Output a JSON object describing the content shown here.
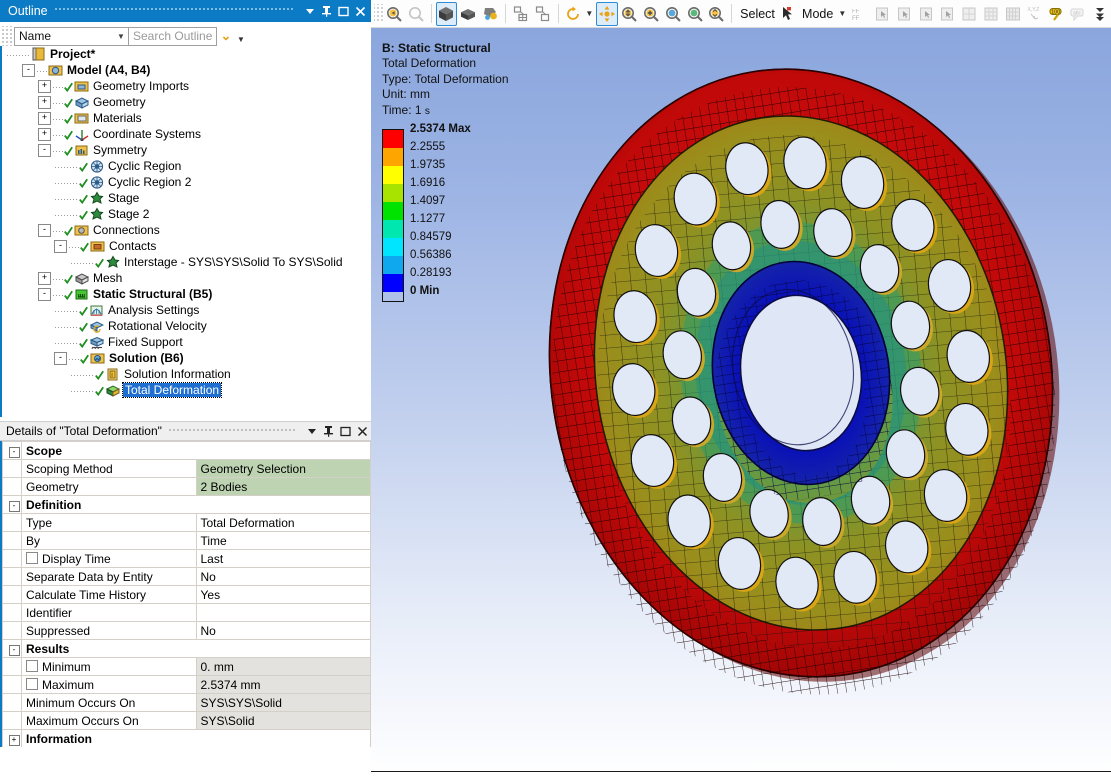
{
  "outline_panel": {
    "title": "Outline",
    "window_buttons": [
      "dropdown-arrow",
      "pin",
      "maximize",
      "close"
    ],
    "search": {
      "filter_value": "Name",
      "placeholder": "Search Outline",
      "expand_label": "⌄"
    },
    "tree": [
      {
        "label": "Project*",
        "depth": 0,
        "bold": true,
        "expander": "",
        "check": false,
        "icon": "project-icon",
        "selected": false
      },
      {
        "label": "Model (A4, B4)",
        "depth": 1,
        "bold": true,
        "expander": "-",
        "check": false,
        "icon": "model-icon",
        "selected": false
      },
      {
        "label": "Geometry Imports",
        "depth": 2,
        "bold": false,
        "expander": "+",
        "check": true,
        "icon": "geometry-imports-icon",
        "selected": false
      },
      {
        "label": "Geometry",
        "depth": 2,
        "bold": false,
        "expander": "+",
        "check": true,
        "icon": "geometry-icon",
        "selected": false
      },
      {
        "label": "Materials",
        "depth": 2,
        "bold": false,
        "expander": "+",
        "check": true,
        "icon": "materials-icon",
        "selected": false
      },
      {
        "label": "Coordinate Systems",
        "depth": 2,
        "bold": false,
        "expander": "+",
        "check": true,
        "icon": "coordinate-systems-icon",
        "selected": false
      },
      {
        "label": "Symmetry",
        "depth": 2,
        "bold": false,
        "expander": "-",
        "check": true,
        "icon": "symmetry-icon",
        "selected": false
      },
      {
        "label": "Cyclic Region",
        "depth": 3,
        "bold": false,
        "expander": "",
        "check": true,
        "icon": "cyclic-region-icon",
        "selected": false
      },
      {
        "label": "Cyclic Region 2",
        "depth": 3,
        "bold": false,
        "expander": "",
        "check": true,
        "icon": "cyclic-region-icon",
        "selected": false
      },
      {
        "label": "Stage",
        "depth": 3,
        "bold": false,
        "expander": "",
        "check": true,
        "icon": "stage-icon",
        "selected": false
      },
      {
        "label": "Stage 2",
        "depth": 3,
        "bold": false,
        "expander": "",
        "check": true,
        "icon": "stage-icon",
        "selected": false
      },
      {
        "label": "Connections",
        "depth": 2,
        "bold": false,
        "expander": "-",
        "check": true,
        "icon": "connections-icon",
        "selected": false
      },
      {
        "label": "Contacts",
        "depth": 3,
        "bold": false,
        "expander": "-",
        "check": true,
        "icon": "contacts-icon",
        "selected": false
      },
      {
        "label": "Interstage - SYS\\SYS\\Solid To SYS\\Solid",
        "depth": 4,
        "bold": false,
        "expander": "",
        "check": true,
        "icon": "contact-region-icon",
        "selected": false
      },
      {
        "label": "Mesh",
        "depth": 2,
        "bold": false,
        "expander": "+",
        "check": true,
        "icon": "mesh-icon",
        "selected": false
      },
      {
        "label": "Static Structural (B5)",
        "depth": 2,
        "bold": true,
        "expander": "-",
        "check": true,
        "icon": "static-structural-icon",
        "selected": false
      },
      {
        "label": "Analysis Settings",
        "depth": 3,
        "bold": false,
        "expander": "",
        "check": true,
        "icon": "analysis-settings-icon",
        "selected": false
      },
      {
        "label": "Rotational Velocity",
        "depth": 3,
        "bold": false,
        "expander": "",
        "check": true,
        "icon": "rotational-velocity-icon",
        "selected": false
      },
      {
        "label": "Fixed Support",
        "depth": 3,
        "bold": false,
        "expander": "",
        "check": true,
        "icon": "fixed-support-icon",
        "selected": false
      },
      {
        "label": "Solution (B6)",
        "depth": 3,
        "bold": true,
        "expander": "-",
        "check": true,
        "icon": "solution-icon",
        "selected": false
      },
      {
        "label": "Solution Information",
        "depth": 4,
        "bold": false,
        "expander": "",
        "check": true,
        "icon": "solution-information-icon",
        "selected": false
      },
      {
        "label": "Total Deformation",
        "depth": 4,
        "bold": false,
        "expander": "",
        "check": true,
        "icon": "total-deformation-icon",
        "selected": true
      }
    ]
  },
  "details_panel": {
    "title": "Details of \"Total Deformation\"",
    "window_buttons": [
      "dropdown-arrow",
      "pin",
      "maximize",
      "close"
    ],
    "rows": [
      {
        "kind": "section",
        "label": "Scope",
        "expander": "-"
      },
      {
        "kind": "prop",
        "key": "Scoping Method",
        "value": "Geometry Selection",
        "value_style": "green",
        "checkbox": false
      },
      {
        "kind": "prop",
        "key": "Geometry",
        "value": "2 Bodies",
        "value_style": "green",
        "checkbox": false
      },
      {
        "kind": "section",
        "label": "Definition",
        "expander": "-"
      },
      {
        "kind": "prop",
        "key": "Type",
        "value": "Total Deformation",
        "value_style": "plain",
        "checkbox": false
      },
      {
        "kind": "prop",
        "key": "By",
        "value": "Time",
        "value_style": "plain",
        "checkbox": false
      },
      {
        "kind": "prop",
        "key": "Display Time",
        "value": "Last",
        "value_style": "plain",
        "checkbox": true
      },
      {
        "kind": "prop",
        "key": "Separate Data by Entity",
        "value": "No",
        "value_style": "plain",
        "checkbox": false
      },
      {
        "kind": "prop",
        "key": "Calculate Time History",
        "value": "Yes",
        "value_style": "plain",
        "checkbox": false
      },
      {
        "kind": "prop",
        "key": "Identifier",
        "value": "",
        "value_style": "plain",
        "checkbox": false
      },
      {
        "kind": "prop",
        "key": "Suppressed",
        "value": "No",
        "value_style": "plain",
        "checkbox": false
      },
      {
        "kind": "section",
        "label": "Results",
        "expander": "-"
      },
      {
        "kind": "prop",
        "key": "Minimum",
        "value": "0. mm",
        "value_style": "gray",
        "checkbox": true
      },
      {
        "kind": "prop",
        "key": "Maximum",
        "value": "2.5374 mm",
        "value_style": "gray",
        "checkbox": true
      },
      {
        "kind": "prop",
        "key": "Minimum Occurs On",
        "value": "SYS\\SYS\\Solid",
        "value_style": "gray",
        "checkbox": false
      },
      {
        "kind": "prop",
        "key": "Maximum Occurs On",
        "value": "SYS\\Solid",
        "value_style": "gray",
        "checkbox": false
      },
      {
        "kind": "section",
        "label": "Information",
        "expander": "+"
      }
    ]
  },
  "graphics_toolbar": {
    "buttons": [
      {
        "name": "zoom-previous-icon",
        "state": "enabled"
      },
      {
        "name": "zoom-next-icon",
        "state": "disabled"
      },
      {
        "name": "solid-shaded-cube-icon",
        "state": "active"
      },
      {
        "name": "shaded-no-edges-cube-icon",
        "state": "enabled"
      },
      {
        "name": "wireframe-colored-icon",
        "state": "enabled"
      },
      {
        "name": "show-mesh-icon",
        "state": "enabled"
      },
      {
        "name": "show-vertices-icon",
        "state": "enabled"
      },
      {
        "name": "rotate-icon",
        "state": "enabled"
      },
      {
        "name": "pan-icon",
        "state": "active"
      },
      {
        "name": "zoom-icon",
        "state": "enabled"
      },
      {
        "name": "box-zoom-icon",
        "state": "enabled"
      },
      {
        "name": "zoom-to-fit-icon",
        "state": "enabled"
      },
      {
        "name": "magnify-glass-icon",
        "state": "enabled"
      },
      {
        "name": "previous-view-icon",
        "state": "enabled"
      }
    ],
    "select_label": "Select",
    "mode_label": "Mode",
    "right_buttons": [
      {
        "name": "select-type-icon",
        "state": "disabled"
      },
      {
        "name": "single-select-icon",
        "state": "disabled"
      },
      {
        "name": "box-select-icon",
        "state": "disabled"
      },
      {
        "name": "box-volume-select-icon",
        "state": "disabled"
      },
      {
        "name": "lasso-select-icon",
        "state": "disabled"
      },
      {
        "name": "lasso-volume-select-icon",
        "state": "disabled"
      },
      {
        "name": "extend-selection-icon",
        "state": "disabled"
      },
      {
        "name": "select-all-icon",
        "state": "disabled"
      },
      {
        "name": "coordinate-xyz-icon",
        "state": "disabled"
      },
      {
        "name": "probe-ruler-icon",
        "state": "enabled"
      },
      {
        "name": "label-annotation-icon",
        "state": "disabled"
      },
      {
        "name": "toolbar-overflow-icon",
        "state": "enabled"
      }
    ]
  },
  "viewport": {
    "header": {
      "line1": "B: Static Structural",
      "line2": "Total Deformation",
      "line3": "Type: Total Deformation",
      "line4": "Unit: mm",
      "line5_prefix": "Time: 1 ",
      "line5_unit": "s"
    },
    "legend": {
      "entries": [
        {
          "value": "2.5374 Max",
          "color": "#ff0000",
          "bold": true
        },
        {
          "value": "2.2555",
          "color": "#ffa500",
          "bold": false
        },
        {
          "value": "1.9735",
          "color": "#ffff00",
          "bold": false
        },
        {
          "value": "1.6916",
          "color": "#a8e300",
          "bold": false
        },
        {
          "value": "1.4097",
          "color": "#00e300",
          "bold": false
        },
        {
          "value": "1.1277",
          "color": "#00e8b0",
          "bold": false
        },
        {
          "value": "0.84579",
          "color": "#00e5ff",
          "bold": false
        },
        {
          "value": "0.56386",
          "color": "#0fa8ee",
          "bold": false
        },
        {
          "value": "0.28193",
          "color": "#0000ff",
          "bold": false
        },
        {
          "value": "0 Min",
          "color": null,
          "bold": true
        }
      ]
    },
    "model": {
      "name": "cyclic-rotor-disk-result",
      "outer_rim_color": "#c00000",
      "web_color": "#8a9220",
      "mid_green_color": "#2e9c6a",
      "hub_color": "#0a17c8",
      "outer_holes": 18,
      "inner_holes": 14
    }
  }
}
